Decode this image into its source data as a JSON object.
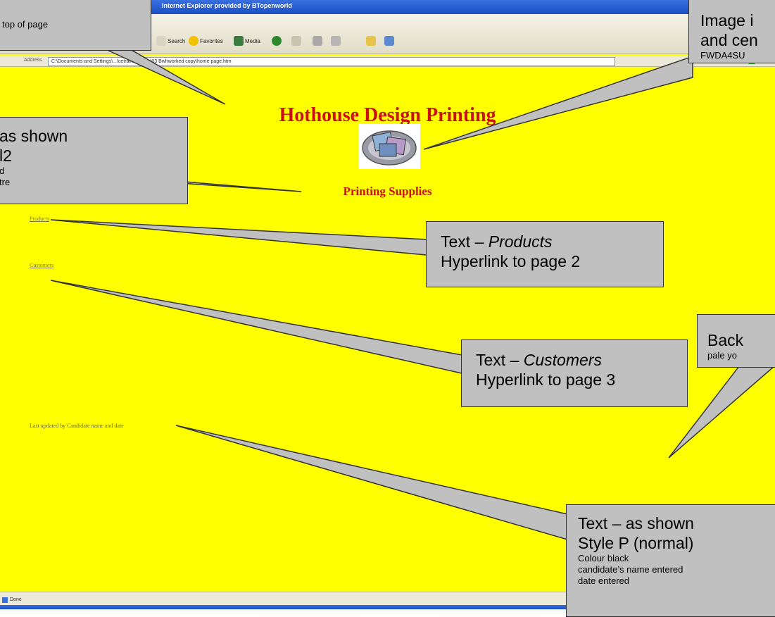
{
  "window": {
    "title": "Internet Explorer provided by BTopenworld"
  },
  "toolbar": {
    "search_label": "Search",
    "favorites_label": "Favorites",
    "media_label": "Media"
  },
  "address_bar": {
    "label": "Address",
    "url": "C:\\Documents and Settings\\...\\cetrain options\\03 Bwhworked copy\\home page.htm",
    "go_label": "Go"
  },
  "page": {
    "heading": "Hothouse Design Printing",
    "sub_heading": "Printing Supplies",
    "products_link": "Products",
    "customers_link": "Customers",
    "last_updated": "Last updated by Candidate name  and date"
  },
  "status_bar": {
    "text": "Done"
  },
  "callouts": {
    "top": {
      "lines": [
        "top of page"
      ]
    },
    "heading": {
      "line1": "as shown",
      "line2": "l2",
      "line3": "d",
      "line4": "tre"
    },
    "image": {
      "line1": "Image i",
      "line2": "and cen",
      "line3": "FWDA4SU"
    },
    "products": {
      "prefix": "Text – ",
      "name": "Products",
      "line2": "Hyperlink to page 2"
    },
    "customers": {
      "prefix": "Text – ",
      "name": "Customers",
      "line2": "Hyperlink to page 3"
    },
    "background": {
      "line1": "Back",
      "line2": "pale yo"
    },
    "text": {
      "line1": "Text – as shown",
      "line2": "Style P (normal)",
      "line3": "Colour black",
      "line4": "candidate’s name entered",
      "line5": "date entered"
    }
  },
  "colors": {
    "page_background": "#ffff00",
    "heading_color": "#cc1010",
    "callout_fill": "#c0c0c0"
  }
}
